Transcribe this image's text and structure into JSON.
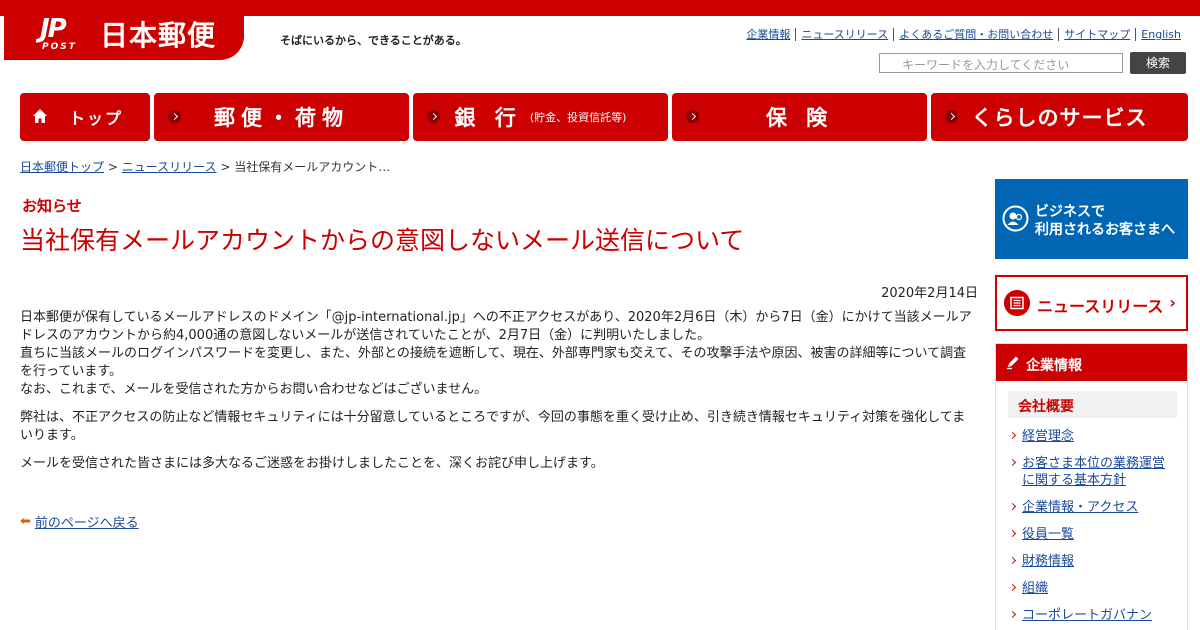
{
  "header": {
    "logo_text": "日本郵便",
    "logo_mark": "JP",
    "logo_post": "POST",
    "tagline": "そばにいるから、できることがある。",
    "links": [
      "企業情報",
      "ニュースリリース",
      "よくあるご質問・お問い合わせ",
      "サイトマップ",
      "English"
    ],
    "search_placeholder": "キーワードを入力してください",
    "search_button": "検索"
  },
  "nav": {
    "home": "トップ",
    "items": [
      {
        "label": "郵便・荷物",
        "sub": ""
      },
      {
        "label": "銀 行",
        "sub": "(貯金、投資信託等)"
      },
      {
        "label": "保 険",
        "sub": ""
      },
      {
        "label": "くらしのサービス",
        "sub": ""
      }
    ]
  },
  "breadcrumb": {
    "home": "日本郵便トップ",
    "news": "ニュースリリース",
    "current": "当社保有メールアカウント…",
    "sep": ">"
  },
  "main": {
    "label": "お知らせ",
    "title": "当社保有メールアカウントからの意図しないメール送信について",
    "date": "2020年2月14日",
    "paragraphs": [
      "日本郵便が保有しているメールアドレスのドメイン「@jp-international.jp」への不正アクセスがあり、2020年2月6日（木）から7日（金）にかけて当該メールアドレスのアカウントから約4,000通の意図しないメールが送信されていたことが、2月7日（金）に判明いたしました。",
      "直ちに当該メールのログインパスワードを変更し、また、外部との接続を遮断して、現在、外部専門家も交えて、その攻撃手法や原因、被害の詳細等について調査を行っています。",
      "なお、これまで、メールを受信された方からお問い合わせなどはございません。",
      "弊社は、不正アクセスの防止など情報セキュリティには十分留意しているところですが、今回の事態を重く受け止め、引き続き情報セキュリティ対策を強化してまいります。",
      "メールを受信された皆さまには多大なるご迷惑をお掛けしましたことを、深くお詫び申し上げます。"
    ],
    "back_link": "前のページへ戻る"
  },
  "sidebar": {
    "business_line1": "ビジネスで",
    "business_line2": "利用されるお客さまへ",
    "news_release": "ニュースリリース",
    "corp_header": "企業情報",
    "corp_sub": "会社概要",
    "corp_items": [
      "経営理念",
      "お客さま本位の業務運営に関する基本方針",
      "企業情報・アクセス",
      "役員一覧",
      "財務情報",
      "組織",
      "コーポレートガバナン"
    ]
  },
  "colors": {
    "brand_red": "#cc0000",
    "business_blue": "#0066b3",
    "link_blue": "#1a4a9a"
  }
}
